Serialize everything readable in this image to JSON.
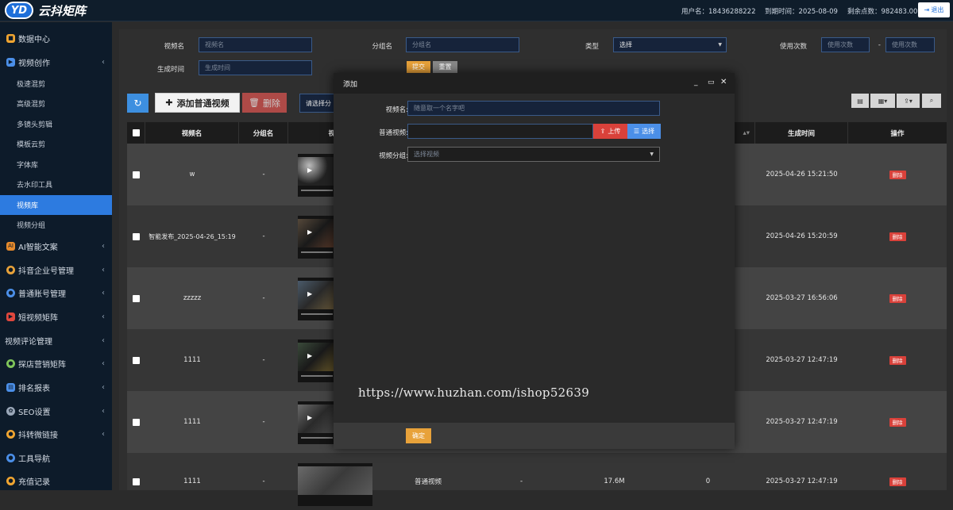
{
  "topbar": {
    "logo_mark": "YD",
    "logo_text": "云抖矩阵",
    "username": "用户名：18436288222",
    "expire": "到期时间：2025-08-09",
    "points": "剩余点数：982483.00",
    "logout": "退出"
  },
  "sidebar": {
    "items": [
      {
        "label": "数据中心",
        "icon": "data-center-icon",
        "color": "#f0a531"
      },
      {
        "label": "视频创作",
        "icon": "video-create-icon",
        "color": "#4b8fe8"
      },
      {
        "label": "AI智能文案",
        "icon": "ai-icon",
        "color": "#e58a2c"
      },
      {
        "label": "抖音企业号管理",
        "icon": "enterprise-icon",
        "color": "#e8a23a"
      },
      {
        "label": "普通账号管理",
        "icon": "account-icon",
        "color": "#4b8fe8"
      },
      {
        "label": "短视频矩阵",
        "icon": "short-video-icon",
        "color": "#e0473d"
      },
      {
        "label": "视频评论管理",
        "icon": "",
        "color": ""
      },
      {
        "label": "探店营销矩阵",
        "icon": "shop-icon",
        "color": "#7fc55a"
      },
      {
        "label": "排名报表",
        "icon": "rank-icon",
        "color": "#4b8fe8"
      },
      {
        "label": "SEO设置",
        "icon": "seo-icon",
        "color": "#9aa7b8"
      },
      {
        "label": "抖转微链接",
        "icon": "link-icon",
        "color": "#f0a531"
      },
      {
        "label": "工具导航",
        "icon": "tool-icon",
        "color": "#4b8fe8"
      },
      {
        "label": "充值记录",
        "icon": "recharge-icon",
        "color": "#f0a531"
      }
    ],
    "sub_items": [
      "极速混剪",
      "高级混剪",
      "多镜头剪辑",
      "模板云剪",
      "字体库",
      "去水印工具",
      "视频库",
      "视频分组"
    ]
  },
  "filters": {
    "video_name_label": "视频名",
    "video_name_placeholder": "视频名",
    "group_label": "分组名",
    "group_placeholder": "分组名",
    "type_label": "类型",
    "type_value": "选择",
    "usage_label": "使用次数",
    "usage_from_placeholder": "使用次数",
    "usage_sep": "-",
    "usage_to_placeholder": "使用次数",
    "created_label": "生成时间",
    "created_placeholder": "生成时间",
    "submit": "提交",
    "reset": "重置"
  },
  "toolbar": {
    "add_label": "添加普通视频",
    "delete_label": "删除",
    "select_label": "请选择分"
  },
  "table": {
    "headers": [
      "视频名",
      "分组名",
      "视",
      "生成时间",
      "操作"
    ],
    "delete_label": "删除",
    "rows": [
      {
        "name": "w",
        "group": "-",
        "created": "2025-04-26 15:21:50"
      },
      {
        "name": "智能发布_2025-04-26_15:19",
        "group": "-",
        "created": "2025-04-26 15:20:59"
      },
      {
        "name": "zzzzz",
        "group": "-",
        "created": "2025-03-27 16:56:06"
      },
      {
        "name": "1111",
        "group": "-",
        "created": "2025-03-27 12:47:19"
      },
      {
        "name": "1111",
        "group": "-",
        "created": "2025-03-27 12:47:19"
      },
      {
        "name": "1111",
        "group": "-",
        "created": "2025-03-27 12:47:19",
        "type": "普通视频",
        "extra": "-",
        "size": "17.6M",
        "count": "0"
      }
    ]
  },
  "modal": {
    "title": "添加",
    "name_label": "视频名:",
    "name_placeholder": "随意取一个名字吧",
    "video_label": "普通视频:",
    "upload": "上传",
    "choose": "选择",
    "group_label": "视频分组:",
    "group_placeholder": "选择视频",
    "confirm": "确定"
  },
  "watermark": "https://www.huzhan.com/ishop52639"
}
